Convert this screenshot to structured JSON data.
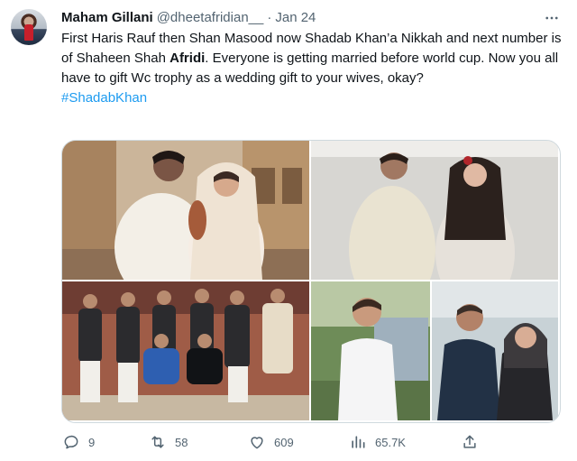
{
  "tweet": {
    "author": {
      "name": "Maham Gillani",
      "handle": "@dheetafridian__",
      "separator": "·",
      "date": "Jan 24"
    },
    "text": {
      "part1": "First Haris Rauf then Shan Masood now Shadab Khan’a Nikkah and next number is of Shaheen Shah ",
      "bold": "Afridi",
      "part2": ". Everyone is getting married before world cup. Now you all have to gift Wc trophy as a wedding gift to your wives, okay?",
      "hashtag": "#ShadabKhan"
    },
    "media": {
      "photos": [
        {
          "subject": "couple in white wedding attire indoors"
        },
        {
          "subject": "couple in cream outfits against white wall"
        },
        {
          "subject": "group of cricketers in formal wear"
        },
        {
          "subject": "two portraits outdoors"
        }
      ]
    },
    "actions": {
      "replies": "9",
      "retweets": "58",
      "likes": "609",
      "views": "65.7K"
    },
    "colors": {
      "text": "#0f1419",
      "secondary": "#536471",
      "link": "#1d9bf0",
      "border": "#cfd9de"
    },
    "icons": [
      "more-icon",
      "reply-icon",
      "retweet-icon",
      "like-icon",
      "views-icon",
      "share-icon"
    ]
  }
}
